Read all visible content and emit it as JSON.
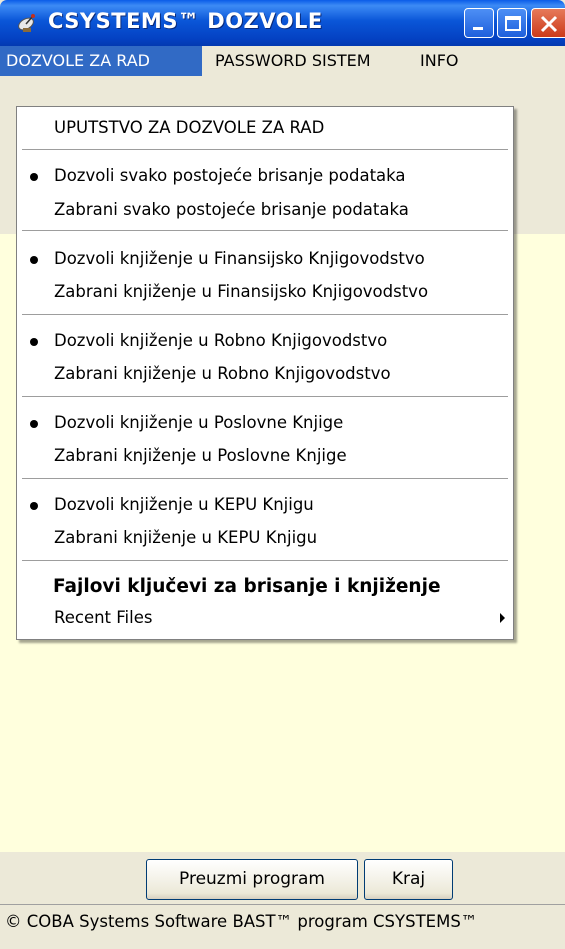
{
  "window": {
    "title": "CSYSTEMS™ DOZVOLE"
  },
  "menubar": [
    {
      "label": "DOZVOLE ZA RAD",
      "active": true
    },
    {
      "label": "PASSWORD SISTEM",
      "active": false
    },
    {
      "label": "INFO",
      "active": false
    }
  ],
  "dropdown": {
    "header": "UPUTSTVO ZA DOZVOLE ZA RAD",
    "groups": [
      {
        "allow": "Dozvoli svako postojeće brisanje podataka",
        "deny": "Zabrani svako postojeće brisanje podataka"
      },
      {
        "allow": "Dozvoli knjiženje u Finansijsko Knjigovodstvo",
        "deny": "Zabrani knjiženje u Finansijsko Knjigovodstvo"
      },
      {
        "allow": "Dozvoli knjiženje u Robno Knjigovodstvo",
        "deny": "Zabrani knjiženje u Robno Knjigovodstvo"
      },
      {
        "allow": "Dozvoli knjiženje u Poslovne Knjige",
        "deny": "Zabrani knjiženje u Poslovne Knjige"
      },
      {
        "allow": "Dozvoli knjiženje u KEPU Knjigu",
        "deny": "Zabrani knjiženje u KEPU Knjigu"
      }
    ],
    "keys_item": "Fajlovi ključevi za brisanje i knjiženje",
    "recent_files": "Recent Files"
  },
  "buttons": {
    "preuzmi": "Preuzmi program",
    "kraj": "Kraj"
  },
  "statusbar": {
    "text": "© COBA Systems Software BAST™ program CSYSTEMS™"
  },
  "icons": {
    "app": "satellite-dish-icon",
    "minimize": "minimize-icon",
    "maximize": "maximize-icon",
    "close": "close-icon",
    "submenu": "submenu-arrow-icon",
    "checked": "radio-bullet-icon"
  },
  "colors": {
    "titlebar": "#0a56d8",
    "menu_highlight": "#316ac5",
    "client_background": "#ffffdd",
    "close_button": "#cc3a1a"
  }
}
